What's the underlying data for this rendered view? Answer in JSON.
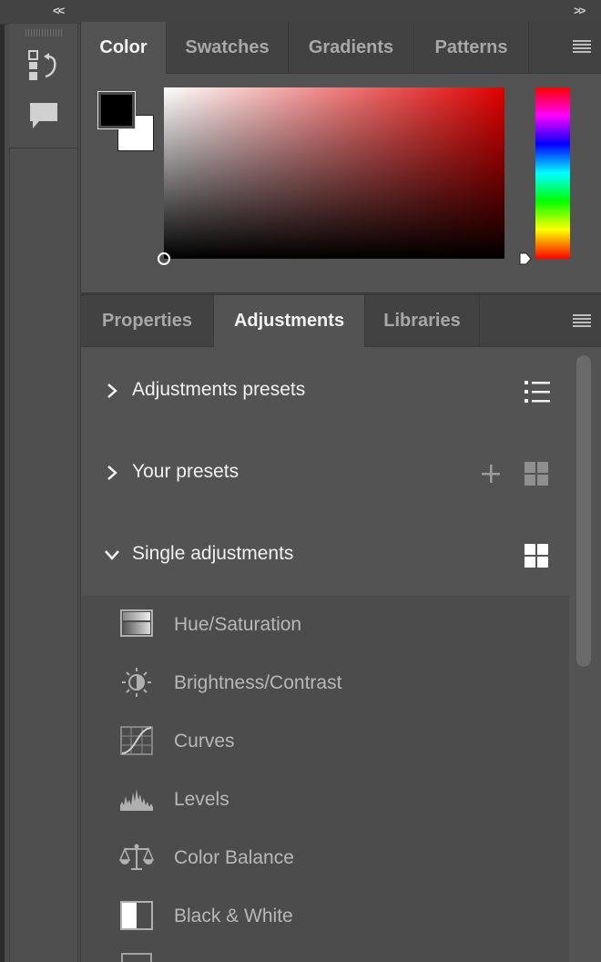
{
  "app": {
    "collapse_left": "<<",
    "collapse_right": ">>"
  },
  "toolstrip": {
    "items": [
      {
        "name": "history-icon"
      },
      {
        "name": "comments-icon"
      }
    ]
  },
  "color_panel": {
    "tabs": [
      {
        "label": "Color",
        "active": true
      },
      {
        "label": "Swatches",
        "active": false
      },
      {
        "label": "Gradients",
        "active": false
      },
      {
        "label": "Patterns",
        "active": false
      }
    ],
    "foreground_color": "#000000",
    "background_color": "#ffffff",
    "field_hue": "#e00000"
  },
  "adjust_panel": {
    "tabs": [
      {
        "label": "Properties",
        "active": false
      },
      {
        "label": "Adjustments",
        "active": true
      },
      {
        "label": "Libraries",
        "active": false
      }
    ],
    "sections": [
      {
        "label": "Adjustments presets",
        "expanded": false,
        "icon": "list-view-icon"
      },
      {
        "label": "Your presets",
        "expanded": false,
        "icons": [
          "add-icon",
          "grid-view-icon"
        ]
      },
      {
        "label": "Single adjustments",
        "expanded": true,
        "icon": "grid-view-icon"
      }
    ],
    "items": [
      {
        "label": "Hue/Saturation",
        "icon": "hue-saturation-icon"
      },
      {
        "label": "Brightness/Contrast",
        "icon": "brightness-contrast-icon"
      },
      {
        "label": "Curves",
        "icon": "curves-icon"
      },
      {
        "label": "Levels",
        "icon": "levels-icon"
      },
      {
        "label": "Color Balance",
        "icon": "color-balance-icon"
      },
      {
        "label": "Black & White",
        "icon": "black-white-icon"
      }
    ]
  }
}
